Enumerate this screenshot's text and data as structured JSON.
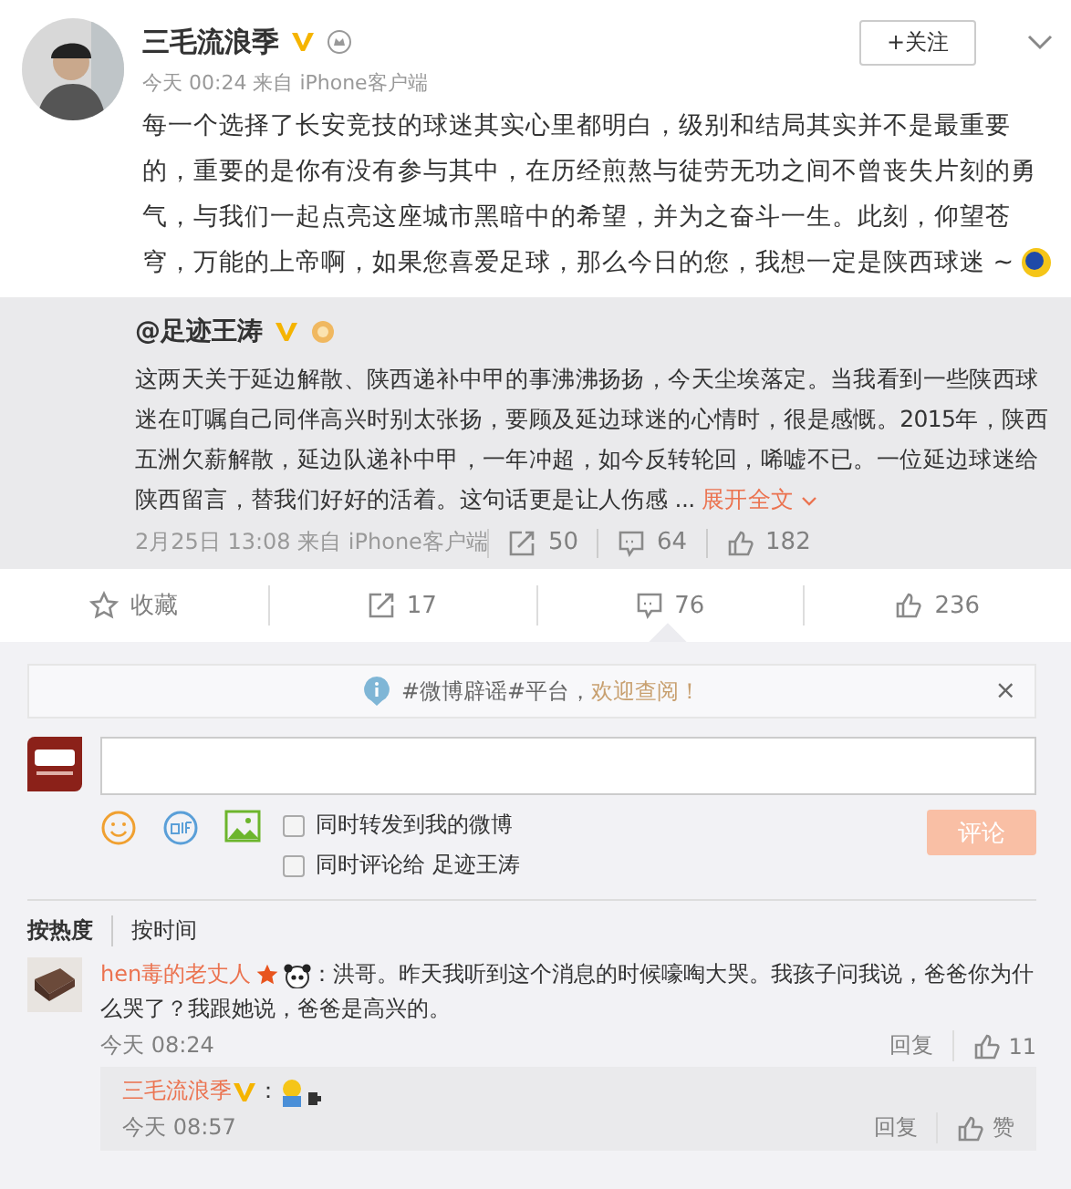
{
  "post": {
    "author": "三毛流浪季",
    "follow": "+关注",
    "time": "今天 00:24 来自 iPhone客户端",
    "text": "每一个选择了长安竞技的球迷其实心里都明白，级别和结局其实并不是最重要的，重要的是你有没有参与其中，在历经煎熬与徒劳无功之间不曾丧失片刻的勇气，与我们一起点亮这座城市黑暗中的希望，并为之奋斗一生。此刻，仰望苍穹，万能的上帝啊，如果您喜爱足球，那么今日的您，我想一定是陕西球迷 ~"
  },
  "repost": {
    "author": "@足迹王涛",
    "text": "这两天关于延边解散、陕西递补中甲的事沸沸扬扬，今天尘埃落定。当我看到一些陕西球迷在叮嘱自己同伴高兴时别太张扬，要顾及延边球迷的心情时，很是感慨。2015年，陕西五洲欠薪解散，延边队递补中甲，一年冲超，如今反转轮回，唏嘘不已。一位延边球迷给陕西留言，替我们好好的活着。这句话更是让人伤感 ...",
    "expand": "展开全文",
    "time": "2月25日 13:08 来自 iPhone客户端",
    "stats": [
      {
        "kind": "share",
        "count": "50"
      },
      {
        "kind": "comment",
        "count": "64"
      },
      {
        "kind": "like",
        "count": "182"
      }
    ]
  },
  "actions": [
    {
      "kind": "star",
      "label": "收藏",
      "selected": false
    },
    {
      "kind": "share",
      "label": "17",
      "selected": false
    },
    {
      "kind": "comment",
      "label": "76",
      "selected": true
    },
    {
      "kind": "like",
      "label": "236",
      "selected": false
    }
  ],
  "notice": {
    "text": "#微博辟谣#平台，",
    "link": "欢迎查阅！",
    "close": "×"
  },
  "composer": {
    "options": [
      {
        "label": "同时转发到我的微博",
        "checked": false
      },
      {
        "label": "同时评论给 足迹王涛",
        "checked": false
      }
    ],
    "submit": "评论",
    "disabled": true
  },
  "sort_tabs": [
    {
      "label": "按热度",
      "selected": true
    },
    {
      "label": "按时间",
      "selected": false
    }
  ],
  "comments": [
    {
      "author": "hen毒的老丈人",
      "text": "：洪哥。昨天我听到这个消息的时候嚎啕大哭。我孩子问我说，爸爸你为什么哭了？我跟她说，爸爸是高兴的。",
      "time": "今天 08:24",
      "reply": "回复",
      "likes": "11",
      "replies": [
        {
          "author": "三毛流浪季",
          "text": "：",
          "time": "今天 08:57",
          "reply": "回复",
          "likes": "赞"
        }
      ]
    }
  ]
}
